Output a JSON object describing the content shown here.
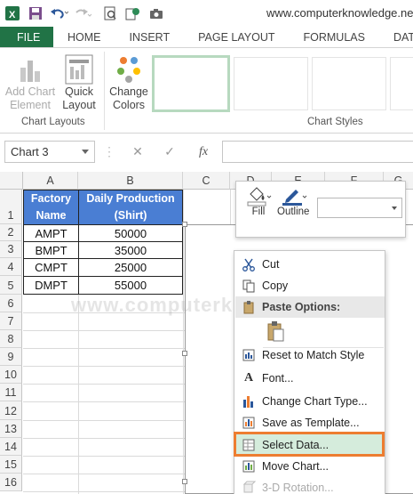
{
  "title_bar": {
    "site": "www.computerknowledge.net"
  },
  "tabs": [
    "FILE",
    "HOME",
    "INSERT",
    "PAGE LAYOUT",
    "FORMULAS",
    "DATA"
  ],
  "ribbon": {
    "add_chart_element": "Add Chart Element",
    "add_chart_element_l1": "Add Chart",
    "add_chart_element_l2": "Element",
    "quick_layout_l1": "Quick",
    "quick_layout_l2": "Layout",
    "change_colors_l1": "Change",
    "change_colors_l2": "Colors",
    "group_chart_layouts": "Chart Layouts",
    "group_chart_styles": "Chart Styles"
  },
  "formula_bar": {
    "name_box": "Chart 3",
    "cancel": "✕",
    "enter": "✓",
    "fx": "fx"
  },
  "columns": [
    "A",
    "B",
    "C",
    "D",
    "E",
    "F",
    "G"
  ],
  "rows": [
    "1",
    "2",
    "3",
    "4",
    "5",
    "6",
    "7",
    "8",
    "9",
    "10",
    "11",
    "12",
    "13",
    "14",
    "15",
    "16"
  ],
  "table": {
    "header_a1": "Factory",
    "header_a2": "Name",
    "header_b1": "Daily Production",
    "header_b2": "(Shirt)",
    "data": [
      {
        "name": "AMPT",
        "value": "50000"
      },
      {
        "name": "BMPT",
        "value": "35000"
      },
      {
        "name": "CMPT",
        "value": "25000"
      },
      {
        "name": "DMPT",
        "value": "55000"
      }
    ]
  },
  "mini_toolbar": {
    "fill": "Fill",
    "outline": "Outline"
  },
  "context_menu": {
    "cut": "Cut",
    "copy": "Copy",
    "paste_options": "Paste Options:",
    "reset": "Reset to Match Style",
    "font": "Font...",
    "change_chart_type": "Change Chart Type...",
    "save_template": "Save as Template...",
    "select_data": "Select Data...",
    "move_chart": "Move Chart...",
    "rotation_3d": "3-D Rotation..."
  },
  "watermark": "www.computerknowledge.net",
  "colors": {
    "excel_green": "#217346",
    "header_blue": "#4a7ed3",
    "highlight_orange": "#ed7d31"
  }
}
